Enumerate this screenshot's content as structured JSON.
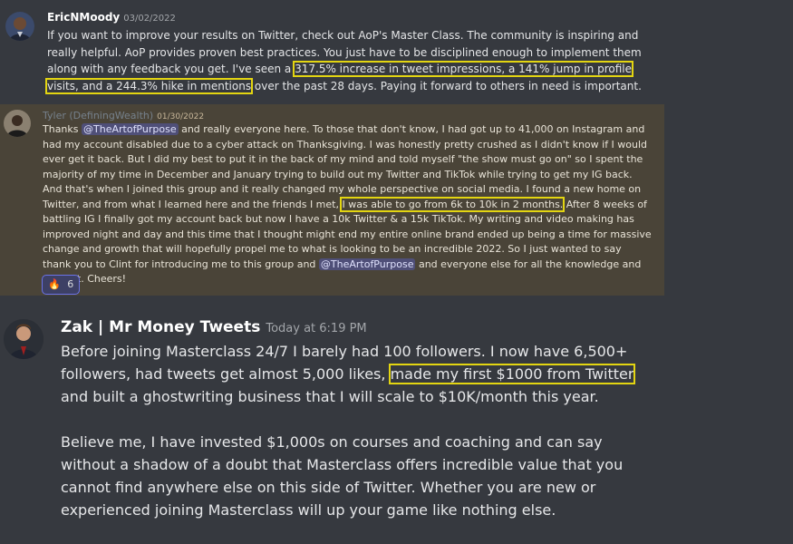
{
  "messages": [
    {
      "username": "EricNMoody",
      "timestamp": "03/02/2022",
      "text_before": "If you want to improve your results on Twitter, check out AoP's Master Class. The community is inspiring and really helpful. AoP provides proven best practices. You just have to be disciplined enough to implement them along with any feedback you get. I've seen a ",
      "highlight": "317.5% increase in tweet impressions, a 141% jump in profile visits, and a 244.3% hike in mentions",
      "text_after": " over the past 28 days. Paying it forward to others in need is important."
    },
    {
      "username": "Tyler (DefiningWealth)",
      "timestamp": "01/30/2022",
      "text_1": "Thanks ",
      "mention_1": "@TheArtofPurpose",
      "text_2": " and really everyone here. To those that don't know, I had got up to 41,000 on Instagram and had my account disabled due to a cyber attack on Thanksgiving. I was honestly pretty crushed as I didn't know if I would ever get it back. But I did my best to put it in the back of my mind and told myself \"the show must go on\" so I spent the majority of my time in December and January trying to build out my Twitter and TikTok while trying to get my IG back. And that's when I joined this group and it really changed my whole perspective on social media. I found a new home on Twitter, and from what I learned here and the friends I met, ",
      "highlight": "I was able to go from 6k to 10k in 2 months.",
      "text_3": " After 8 weeks of battling IG I finally got my account back but now I have a 10k Twitter & a 15k TikTok. My writing and video making has improved night and day and this time that I thought might end my entire online brand ended up being a time for massive change and growth that will hopefully propel me to what is looking to be an incredible 2022. So I just wanted to say thank you to Clint for introducing me to this group and ",
      "mention_2": "@TheArtofPurpose",
      "text_4": " and everyone else for all the knowledge and support. Cheers!",
      "reaction_emoji": "🔥",
      "reaction_count": "6"
    },
    {
      "username": "Zak | Mr Money Tweets",
      "timestamp": "Today at 6:19 PM",
      "p1_before": "Before joining Masterclass 24/7 I barely had 100 followers. I now have 6,500+ followers, had tweets get almost 5,000 likes, ",
      "highlight": "made my first $1000 from Twitter",
      "p1_after": " and built a ghostwriting business that I will scale to $10K/month this year.",
      "p2": "Believe me, I have invested $1,000s on courses and coaching and can say without a shadow of a doubt that Masterclass offers incredible value that you cannot find anywhere else on this side of Twitter. Whether you are new or experienced joining Masterclass will up your game like nothing else."
    }
  ],
  "colors": {
    "background": "#36393f",
    "highlight_box": "#e3d511",
    "highlighted_message_bg": "#4a4438",
    "mention_bg": "#5865f2"
  }
}
